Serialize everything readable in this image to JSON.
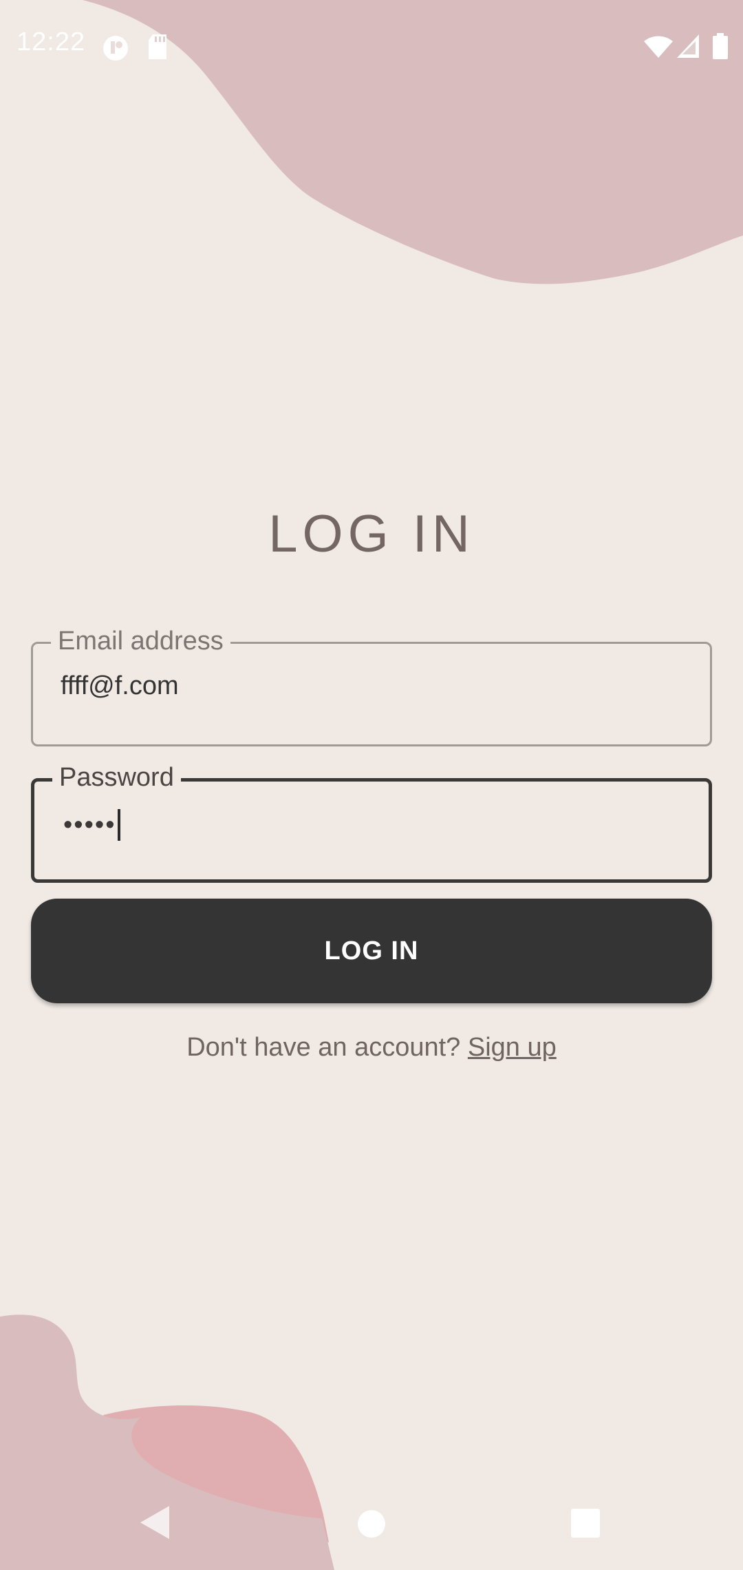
{
  "status_bar": {
    "time": "12:22",
    "icons": [
      "circle-app-icon",
      "sd-card-icon",
      "wifi-icon",
      "signal-icon",
      "battery-icon"
    ]
  },
  "page": {
    "title": "LOG IN"
  },
  "form": {
    "email": {
      "label": "Email address",
      "value": "ffff@f.com"
    },
    "password": {
      "label": "Password",
      "masked_value": "•••••"
    },
    "submit_label": "LOG IN",
    "signup_prompt": "Don't have an account?",
    "signup_link": "Sign up"
  },
  "nav_bar": {
    "icons": [
      "back-icon",
      "home-icon",
      "recents-icon"
    ]
  },
  "colors": {
    "background": "#f0e9e4",
    "blob_pink": "#d8bcbe",
    "blob_rose": "#e0adb0",
    "button": "#343434",
    "title": "#746663"
  }
}
